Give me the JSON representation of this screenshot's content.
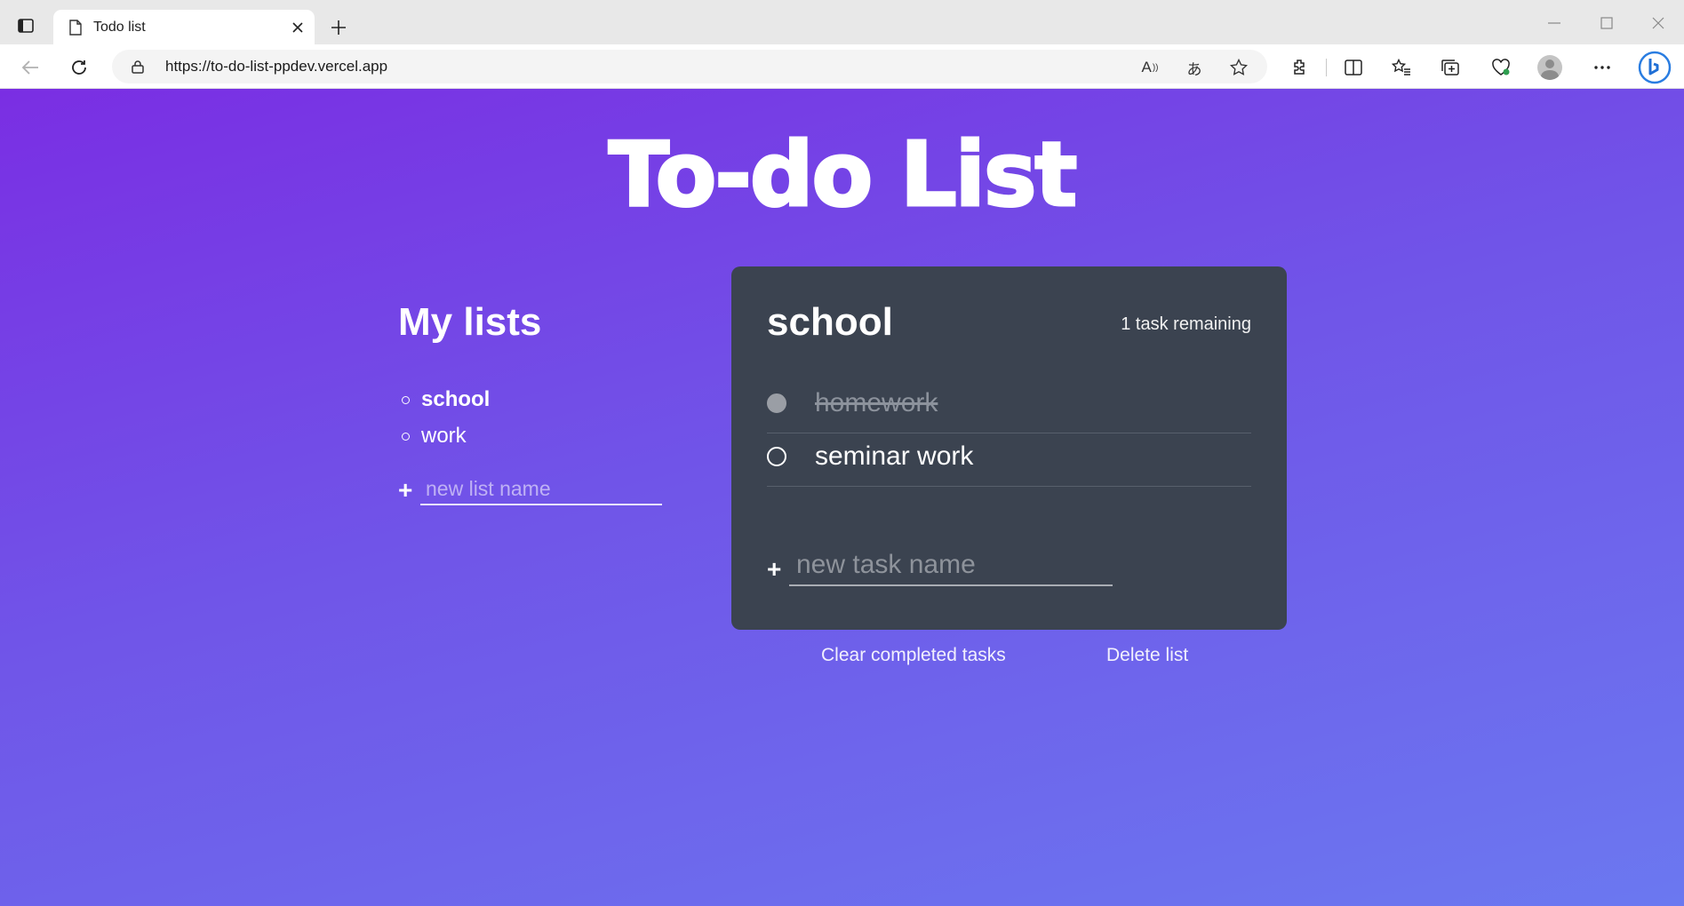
{
  "browser": {
    "tab_title": "Todo list",
    "url": "https://to-do-list-ppdev.vercel.app"
  },
  "page": {
    "title": "To-do List",
    "sidebar": {
      "heading": "My lists",
      "lists": [
        {
          "name": "school",
          "active": true
        },
        {
          "name": "work",
          "active": false
        }
      ],
      "new_list_placeholder": "new list name",
      "add_symbol": "+"
    },
    "todo": {
      "list_title": "school",
      "remaining": "1 task remaining",
      "tasks": [
        {
          "name": "homework",
          "done": true
        },
        {
          "name": "seminar work",
          "done": false
        }
      ],
      "new_task_placeholder": "new task name",
      "add_symbol": "+"
    },
    "actions": {
      "clear_completed": "Clear completed tasks",
      "delete_list": "Delete list"
    }
  },
  "colors": {
    "gradient_start": "#7a2ee3",
    "gradient_end": "#6b78f0",
    "card_bg": "#3b4350",
    "done_text": "#8c929c"
  }
}
